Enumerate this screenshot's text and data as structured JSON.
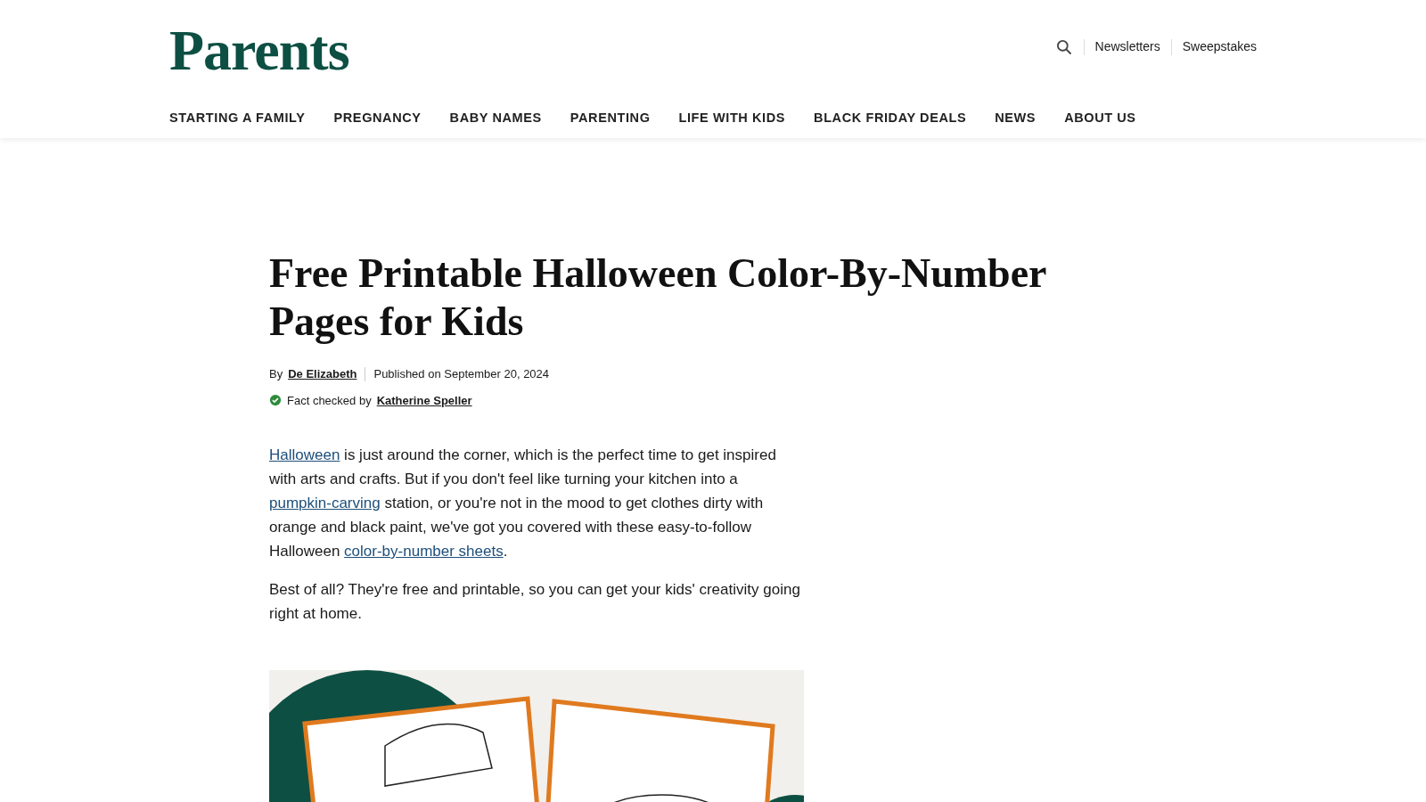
{
  "header": {
    "logo": "Parents",
    "utility_links": [
      "Newsletters",
      "Sweepstakes"
    ],
    "nav": [
      "STARTING A FAMILY",
      "PREGNANCY",
      "BABY NAMES",
      "PARENTING",
      "LIFE WITH KIDS",
      "BLACK FRIDAY DEALS",
      "NEWS",
      "ABOUT US"
    ]
  },
  "article": {
    "title": "Free Printable Halloween Color-By-Number Pages for Kids",
    "byline": {
      "by": "By",
      "author": "De Elizabeth",
      "published": "Published on September 20, 2024",
      "fact_check_label": "Fact checked by",
      "fact_checker": "Katherine Speller",
      "verified": true
    },
    "paragraphs": [
      [
        {
          "kind": "link",
          "text": "Halloween"
        },
        {
          "kind": "text",
          "text": " is just around the corner, which is the perfect time to get inspired with arts and crafts. But if you don't feel like turning your kitchen into a "
        },
        {
          "kind": "link",
          "text": "pumpkin-carving"
        },
        {
          "kind": "text",
          "text": " station, or you're not in the mood to get clothes dirty with orange and black paint, we've got you covered with these easy-to-follow Halloween "
        },
        {
          "kind": "link",
          "text": "color-by-number sheets"
        },
        {
          "kind": "text",
          "text": "."
        }
      ],
      [
        {
          "kind": "text",
          "text": "Best of all? They're free and printable, so you can get your kids' creativity going right at home."
        }
      ]
    ]
  }
}
